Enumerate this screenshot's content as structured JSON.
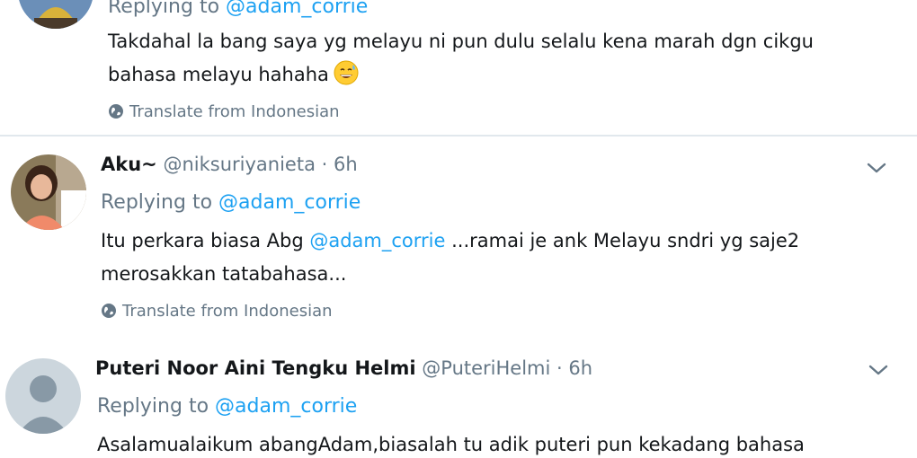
{
  "tweets": [
    {
      "replying_prefix": "Replying to ",
      "replying_mention": "@adam_corrie",
      "body_line1": "Takdahal la bang saya yg melayu ni pun dulu selalu kena marah dgn cikgu",
      "body_line2": "bahasa melayu hahaha",
      "emoji": "grinning-sweat-emoji",
      "translate": "Translate from Indonesian"
    },
    {
      "display_name": "Aku~",
      "handle": "@niksuriyanieta",
      "separator": "·",
      "time": "6h",
      "replying_prefix": "Replying to ",
      "replying_mention": "@adam_corrie",
      "body_line1_pre": "Itu perkara biasa Abg ",
      "body_line1_mention": "@adam_corrie",
      "body_line1_post": " ...ramai je ank Melayu sndri yg saje2",
      "body_line2": "merosakkan tatabahasa...",
      "translate": "Translate from Indonesian"
    },
    {
      "display_name": "Puteri Noor Aini Tengku Helmi",
      "handle": "@PuteriHelmi",
      "separator": "·",
      "time": "6h",
      "replying_prefix": "Replying to ",
      "replying_mention": "@adam_corrie",
      "body_line1": "Asalamualaikum abangAdam,biasalah tu adik puteri pun kekadang bahasa"
    }
  ],
  "colors": {
    "link": "#1da1f2",
    "secondary_text": "#657786",
    "primary_text": "#14171a",
    "divider": "#e1e8ed"
  }
}
